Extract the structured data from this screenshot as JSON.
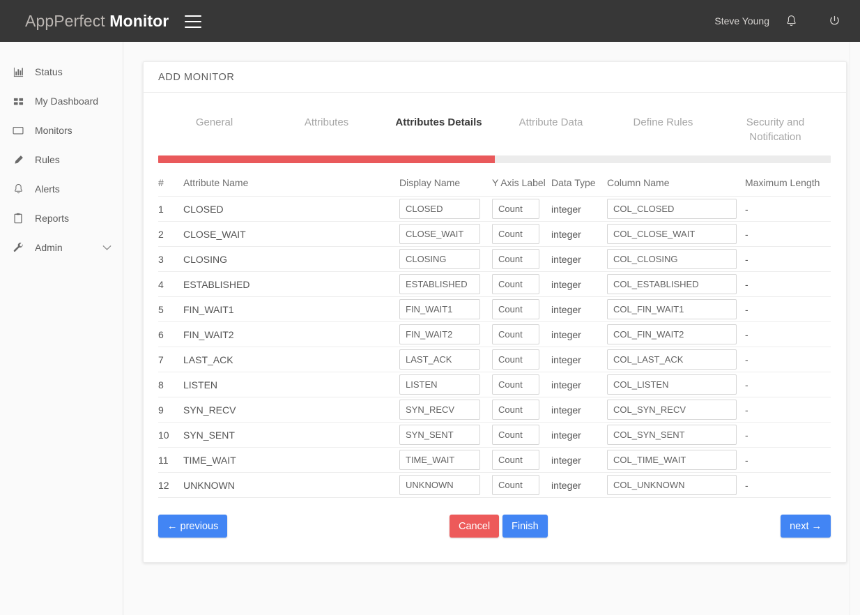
{
  "header": {
    "brand_light": "AppPerfect",
    "brand_bold": "Monitor",
    "menu_icon": "hamburger-icon",
    "user_name": "Steve Young",
    "bell_icon": "bell-icon",
    "power_icon": "power-icon"
  },
  "sidebar": {
    "items": [
      {
        "label": "Status",
        "icon": "bar-chart-icon",
        "chevron": false
      },
      {
        "label": "My Dashboard",
        "icon": "grid-icon",
        "chevron": false
      },
      {
        "label": "Monitors",
        "icon": "monitor-icon",
        "chevron": false
      },
      {
        "label": "Rules",
        "icon": "pencil-icon",
        "chevron": false
      },
      {
        "label": "Alerts",
        "icon": "bell-icon",
        "chevron": false
      },
      {
        "label": "Reports",
        "icon": "clipboard-icon",
        "chevron": false
      },
      {
        "label": "Admin",
        "icon": "wrench-icon",
        "chevron": true
      }
    ]
  },
  "card": {
    "title": "ADD MONITOR"
  },
  "wizard": {
    "tabs": [
      {
        "label": "General",
        "active": false
      },
      {
        "label": "Attributes",
        "active": false
      },
      {
        "label": "Attributes Details",
        "active": true
      },
      {
        "label": "Attribute Data",
        "active": false
      },
      {
        "label": "Define Rules",
        "active": false
      },
      {
        "label": "Security and Notification",
        "active": false
      }
    ],
    "progress_percent": 50,
    "progress_color": "#e9595b"
  },
  "table": {
    "columns": [
      "#",
      "Attribute Name",
      "Display Name",
      "Y Axis Label",
      "Data Type",
      "Column Name",
      "Maximum Length"
    ],
    "rows": [
      {
        "num": "1",
        "attribute": "CLOSED",
        "display": "CLOSED",
        "yaxis": "Count",
        "type": "integer",
        "column": "COL_CLOSED",
        "max": "-"
      },
      {
        "num": "2",
        "attribute": "CLOSE_WAIT",
        "display": "CLOSE_WAIT",
        "yaxis": "Count",
        "type": "integer",
        "column": "COL_CLOSE_WAIT",
        "max": "-"
      },
      {
        "num": "3",
        "attribute": "CLOSING",
        "display": "CLOSING",
        "yaxis": "Count",
        "type": "integer",
        "column": "COL_CLOSING",
        "max": "-"
      },
      {
        "num": "4",
        "attribute": "ESTABLISHED",
        "display": "ESTABLISHED",
        "yaxis": "Count",
        "type": "integer",
        "column": "COL_ESTABLISHED",
        "max": "-"
      },
      {
        "num": "5",
        "attribute": "FIN_WAIT1",
        "display": "FIN_WAIT1",
        "yaxis": "Count",
        "type": "integer",
        "column": "COL_FIN_WAIT1",
        "max": "-"
      },
      {
        "num": "6",
        "attribute": "FIN_WAIT2",
        "display": "FIN_WAIT2",
        "yaxis": "Count",
        "type": "integer",
        "column": "COL_FIN_WAIT2",
        "max": "-"
      },
      {
        "num": "7",
        "attribute": "LAST_ACK",
        "display": "LAST_ACK",
        "yaxis": "Count",
        "type": "integer",
        "column": "COL_LAST_ACK",
        "max": "-"
      },
      {
        "num": "8",
        "attribute": "LISTEN",
        "display": "LISTEN",
        "yaxis": "Count",
        "type": "integer",
        "column": "COL_LISTEN",
        "max": "-"
      },
      {
        "num": "9",
        "attribute": "SYN_RECV",
        "display": "SYN_RECV",
        "yaxis": "Count",
        "type": "integer",
        "column": "COL_SYN_RECV",
        "max": "-"
      },
      {
        "num": "10",
        "attribute": "SYN_SENT",
        "display": "SYN_SENT",
        "yaxis": "Count",
        "type": "integer",
        "column": "COL_SYN_SENT",
        "max": "-"
      },
      {
        "num": "11",
        "attribute": "TIME_WAIT",
        "display": "TIME_WAIT",
        "yaxis": "Count",
        "type": "integer",
        "column": "COL_TIME_WAIT",
        "max": "-"
      },
      {
        "num": "12",
        "attribute": "UNKNOWN",
        "display": "UNKNOWN",
        "yaxis": "Count",
        "type": "integer",
        "column": "COL_UNKNOWN",
        "max": "-"
      }
    ]
  },
  "footer": {
    "previous_label": "← previous",
    "cancel_label": "Cancel",
    "finish_label": "Finish",
    "next_label": "next →"
  },
  "colors": {
    "accent_blue": "#4285f4",
    "accent_red": "#ed5a5a",
    "topbar": "#373737"
  }
}
